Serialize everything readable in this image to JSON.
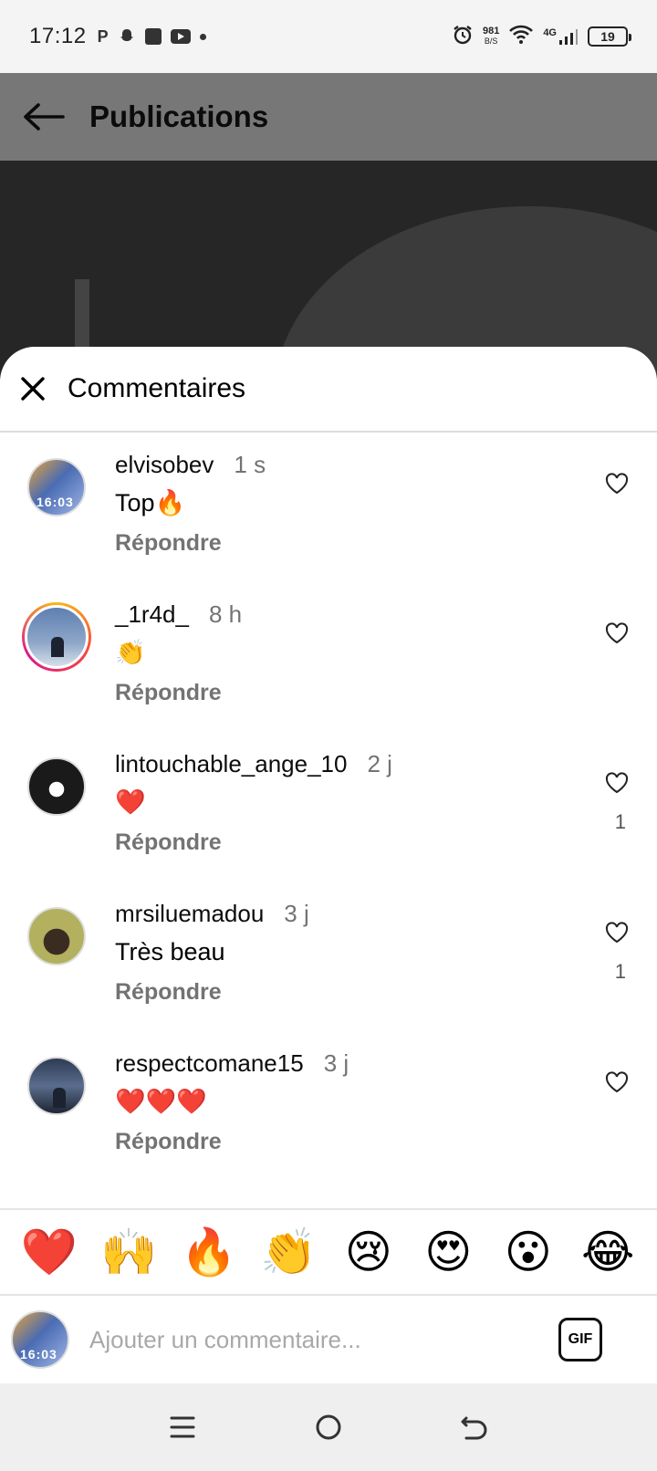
{
  "status_bar": {
    "time": "17:12",
    "net_speed": "981",
    "net_unit": "B/S",
    "network": "4G",
    "battery": "19",
    "left_icons": [
      "p-icon",
      "snapchat-icon",
      "square-icon",
      "youtube-icon",
      "dot-icon"
    ]
  },
  "app_bar": {
    "title": "Publications"
  },
  "sheet": {
    "title": "Commentaires"
  },
  "comments": [
    {
      "user": "elvisobev",
      "time": "1 s",
      "text": "Top🔥",
      "reply": "Répondre",
      "likes": ""
    },
    {
      "user": "_1r4d_",
      "time": "8 h",
      "text": "👏",
      "reply": "Répondre",
      "likes": ""
    },
    {
      "user": "lintouchable_ange_10",
      "time": "2 j",
      "text": "❤️",
      "reply": "Répondre",
      "likes": "1"
    },
    {
      "user": "mrsiluemadou",
      "time": "3 j",
      "text": "Très beau",
      "reply": "Répondre",
      "likes": "1"
    },
    {
      "user": "respectcomane15",
      "time": "3 j",
      "text": "❤️❤️❤️",
      "reply": "Répondre",
      "likes": ""
    }
  ],
  "avatar_badge": "16:03",
  "emoji_bar": [
    "❤️",
    "🙌",
    "🔥",
    "👏",
    "😢",
    "😍",
    "😮",
    "😂"
  ],
  "composer": {
    "placeholder": "Ajouter un commentaire...",
    "gif_label": "GIF"
  },
  "colors": {
    "header_overlay": "#777777",
    "secondary_text": "#737373",
    "ring_gradient": [
      "#f9b916",
      "#f6433f",
      "#d91a8c"
    ]
  }
}
